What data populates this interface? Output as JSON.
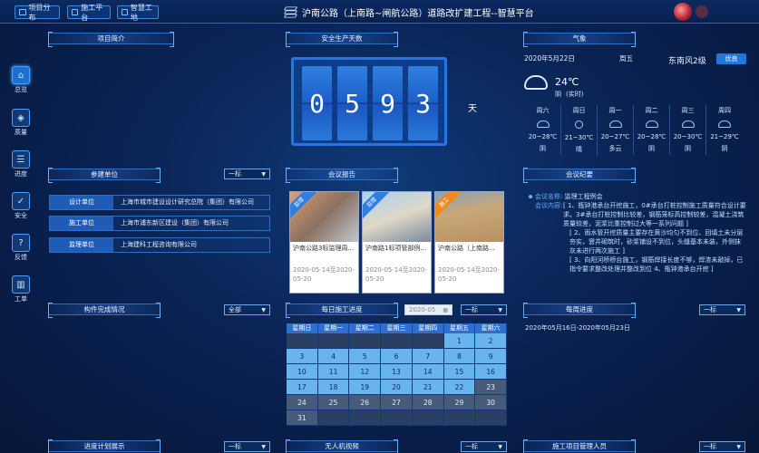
{
  "header": {
    "nav": [
      {
        "label": "项目分布"
      },
      {
        "label": "施工平台"
      },
      {
        "label": "智慧工地"
      }
    ],
    "title": "沪南公路（上南路~闸航公路）道路改扩建工程--智慧平台"
  },
  "sidebar": {
    "items": [
      {
        "label": "总览",
        "icon": "home-icon"
      },
      {
        "label": "质量",
        "icon": "shield-icon"
      },
      {
        "label": "进度",
        "icon": "list-icon"
      },
      {
        "label": "安全",
        "icon": "shield-check-icon"
      },
      {
        "label": "反馈",
        "icon": "question-icon"
      },
      {
        "label": "工单",
        "icon": "chart-icon"
      }
    ]
  },
  "sections": {
    "project_intro": "项目简介",
    "safety_days": "安全生产天数",
    "weather": "气象",
    "participants": "参建单位",
    "meeting_report": "会议报告",
    "meeting_minutes": "会议纪要",
    "components": "构件完成情况",
    "daily_progress": "每日施工进度",
    "weekly_progress": "每周进度",
    "plan_display": "进度计划展示",
    "drone_video": "无人机视频",
    "personnel": "施工项目管理人员"
  },
  "dropdowns": {
    "participants": "一标",
    "components": "全部",
    "daily_month": "2020-05",
    "daily_lot": "一标",
    "weekly": "一标",
    "plan": "一标",
    "drone": "一标",
    "personnel": "一标"
  },
  "safety": {
    "digits": [
      "0",
      "5",
      "9",
      "3"
    ],
    "unit": "天"
  },
  "weather": {
    "date": "2020年5月22日",
    "weekday": "周五",
    "wind": "东南风2级",
    "aqi": "优良",
    "temp": "24℃",
    "condition": "阴",
    "realtime": "(实时)",
    "forecast": [
      {
        "day": "周六",
        "range": "20~28℃",
        "cond": "阴"
      },
      {
        "day": "周日",
        "range": "21~30℃",
        "cond": "晴"
      },
      {
        "day": "周一",
        "range": "20~27℃",
        "cond": "多云"
      },
      {
        "day": "周二",
        "range": "20~28℃",
        "cond": "阴"
      },
      {
        "day": "周三",
        "range": "20~30℃",
        "cond": "阴"
      },
      {
        "day": "周四",
        "range": "21~29℃",
        "cond": "阴"
      }
    ]
  },
  "participants": [
    {
      "role": "设计单位",
      "name": "上海市城市建设设计研究总院（集团）有限公司"
    },
    {
      "role": "施工单位",
      "name": "上海市浦东新区建设（集团）有限公司"
    },
    {
      "role": "监理单位",
      "name": "上海建科工程咨询有限公司"
    }
  ],
  "reports": [
    {
      "tag": "监理",
      "title": "沪南公路3标监理周...",
      "date": "2020-05-14至2020-05-20",
      "color": "#2f7fe0"
    },
    {
      "tag": "监理",
      "title": "沪南路1标项管部例...",
      "date": "2020-05-14至2020-05-20",
      "color": "#2f7fe0"
    },
    {
      "tag": "施工",
      "title": "沪南公路（上南路...",
      "date": "2020-05-14至2020-05-20",
      "color": "#f08a20"
    }
  ],
  "minutes": {
    "name_label": "会议名称:",
    "name": "监理工程例会",
    "content_label": "会议内容:",
    "items": [
      "[ 1、瓶钟港承台开挖施工，0#承台打桩控制施工质量符合设计要求。3#承台打桩控制比较差，钢筋笼标高控制较差，混凝土浇筑质量较差，泥浆比重控制过大等一系列问题 ]",
      "[ 2、雨水管开挖质量主要存在黄沙均匀不到位、回填土未分层夯实，窨井砌筑时，砂浆铺设不到位，头缝基本未装，外侧抹灰未进行两次施工 ]",
      "[ 3、向阳河桥桥台施工，钢筋焊接长度不够，焊渣未敲掉，已指令要求整改处理并整改到位 4、瓶钟港承台开挖 ]"
    ]
  },
  "calendar": {
    "headers": [
      "星期日",
      "星期一",
      "星期二",
      "星期三",
      "星期四",
      "星期五",
      "星期六"
    ],
    "weeks": [
      [
        "",
        "",
        "",
        "",
        "",
        "1",
        "2"
      ],
      [
        "3",
        "4",
        "5",
        "6",
        "7",
        "8",
        "9"
      ],
      [
        "10",
        "11",
        "12",
        "13",
        "14",
        "15",
        "16"
      ],
      [
        "17",
        "18",
        "19",
        "20",
        "21",
        "22",
        "23"
      ],
      [
        "24",
        "25",
        "26",
        "27",
        "28",
        "29",
        "30"
      ],
      [
        "31",
        "",
        "",
        "",
        "",
        "",
        ""
      ]
    ]
  },
  "weekly": {
    "range": "2020年05月16日-2020年05月23日"
  }
}
